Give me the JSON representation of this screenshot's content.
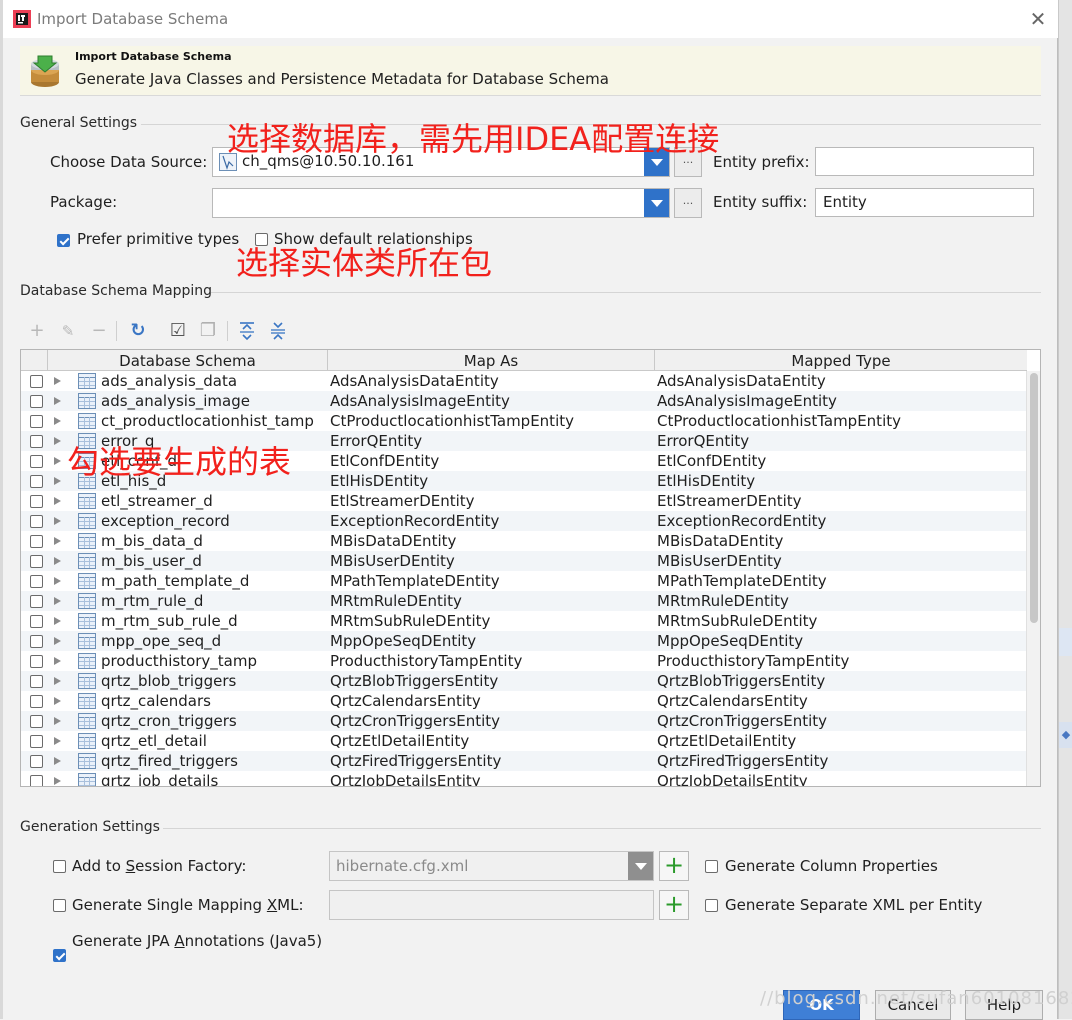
{
  "window": {
    "title": "Import Database Schema",
    "close_glyph": "✕"
  },
  "header": {
    "title": "Import Database Schema",
    "subtitle": "Generate Java Classes and Persistence Metadata for Database Schema"
  },
  "general": {
    "section_label": "General Settings",
    "data_source_label": "Choose Data Source:",
    "data_source_value": "ch_qms@10.50.10.161",
    "package_label": "Package:",
    "package_value": "",
    "entity_prefix_label": "Entity prefix:",
    "entity_prefix_value": "",
    "entity_suffix_label": "Entity suffix:",
    "entity_suffix_value": "Entity",
    "prefer_primitive_label": "Prefer primitive types",
    "prefer_primitive_checked": true,
    "show_relationships_label": "Show default relationships",
    "show_relationships_checked": false,
    "dots_label": "..."
  },
  "annotations": {
    "choose_db": "选择数据库，需先用IDEA配置连接",
    "choose_package": "选择实体类所在包",
    "check_tables": "勾选要生成的表"
  },
  "mapping": {
    "section_label": "Database Schema Mapping",
    "toolbar_icons": [
      "add-icon",
      "edit-icon",
      "remove-icon",
      "refresh-icon",
      "check-all-icon",
      "uncheck-all-icon",
      "expand-all-icon",
      "collapse-all-icon"
    ],
    "columns": [
      "Database Schema",
      "Map As",
      "Mapped Type"
    ],
    "rows": [
      {
        "schema": "ads_analysis_data",
        "map_as": "AdsAnalysisDataEntity",
        "mapped_type": "AdsAnalysisDataEntity"
      },
      {
        "schema": "ads_analysis_image",
        "map_as": "AdsAnalysisImageEntity",
        "mapped_type": "AdsAnalysisImageEntity"
      },
      {
        "schema": "ct_productlocationhist_tamp",
        "map_as": "CtProductlocationhistTampEntity",
        "mapped_type": "CtProductlocationhistTampEntity"
      },
      {
        "schema": "error_q",
        "map_as": "ErrorQEntity",
        "mapped_type": "ErrorQEntity"
      },
      {
        "schema": "etl_conf_d",
        "map_as": "EtlConfDEntity",
        "mapped_type": "EtlConfDEntity"
      },
      {
        "schema": "etl_his_d",
        "map_as": "EtlHisDEntity",
        "mapped_type": "EtlHisDEntity"
      },
      {
        "schema": "etl_streamer_d",
        "map_as": "EtlStreamerDEntity",
        "mapped_type": "EtlStreamerDEntity"
      },
      {
        "schema": "exception_record",
        "map_as": "ExceptionRecordEntity",
        "mapped_type": "ExceptionRecordEntity"
      },
      {
        "schema": "m_bis_data_d",
        "map_as": "MBisDataDEntity",
        "mapped_type": "MBisDataDEntity"
      },
      {
        "schema": "m_bis_user_d",
        "map_as": "MBisUserDEntity",
        "mapped_type": "MBisUserDEntity"
      },
      {
        "schema": "m_path_template_d",
        "map_as": "MPathTemplateDEntity",
        "mapped_type": "MPathTemplateDEntity"
      },
      {
        "schema": "m_rtm_rule_d",
        "map_as": "MRtmRuleDEntity",
        "mapped_type": "MRtmRuleDEntity"
      },
      {
        "schema": "m_rtm_sub_rule_d",
        "map_as": "MRtmSubRuleDEntity",
        "mapped_type": "MRtmSubRuleDEntity"
      },
      {
        "schema": "mpp_ope_seq_d",
        "map_as": "MppOpeSeqDEntity",
        "mapped_type": "MppOpeSeqDEntity"
      },
      {
        "schema": "producthistory_tamp",
        "map_as": "ProducthistoryTampEntity",
        "mapped_type": "ProducthistoryTampEntity"
      },
      {
        "schema": "qrtz_blob_triggers",
        "map_as": "QrtzBlobTriggersEntity",
        "mapped_type": "QrtzBlobTriggersEntity"
      },
      {
        "schema": "qrtz_calendars",
        "map_as": "QrtzCalendarsEntity",
        "mapped_type": "QrtzCalendarsEntity"
      },
      {
        "schema": "qrtz_cron_triggers",
        "map_as": "QrtzCronTriggersEntity",
        "mapped_type": "QrtzCronTriggersEntity"
      },
      {
        "schema": "qrtz_etl_detail",
        "map_as": "QrtzEtlDetailEntity",
        "mapped_type": "QrtzEtlDetailEntity"
      },
      {
        "schema": "qrtz_fired_triggers",
        "map_as": "QrtzFiredTriggersEntity",
        "mapped_type": "QrtzFiredTriggersEntity"
      },
      {
        "schema": "qrtz_job_details",
        "map_as": "QrtzJobDetailsEntity",
        "mapped_type": "QrtzJobDetailsEntity"
      }
    ]
  },
  "generation": {
    "section_label": "Generation Settings",
    "add_session_factory": {
      "pre": "Add to ",
      "ul": "S",
      "post": "ession Factory:",
      "checked": false
    },
    "session_factory_value": "hibernate.cfg.xml",
    "single_mapping_xml": {
      "pre": "Generate Single Mapping ",
      "ul": "X",
      "post": "ML:",
      "checked": false
    },
    "single_mapping_value": "",
    "jpa_annotations": {
      "pre": "Generate JPA ",
      "ul": "A",
      "post": "nnotations (Java5)",
      "checked": true
    },
    "generate_column_properties": {
      "label": "Generate Column Properties",
      "checked": false
    },
    "separate_xml": {
      "label": "Generate Separate XML per Entity",
      "checked": false
    },
    "plus_label": "+"
  },
  "footer": {
    "ok_label": "OK",
    "cancel_label": "Cancel",
    "help_label": "Help",
    "watermark": "//blog.csdn.net/sufan601081682"
  },
  "colors": {
    "accent": "#2f72c9",
    "annotation": "#f2211c",
    "primary_button": "#3f7fd6"
  }
}
